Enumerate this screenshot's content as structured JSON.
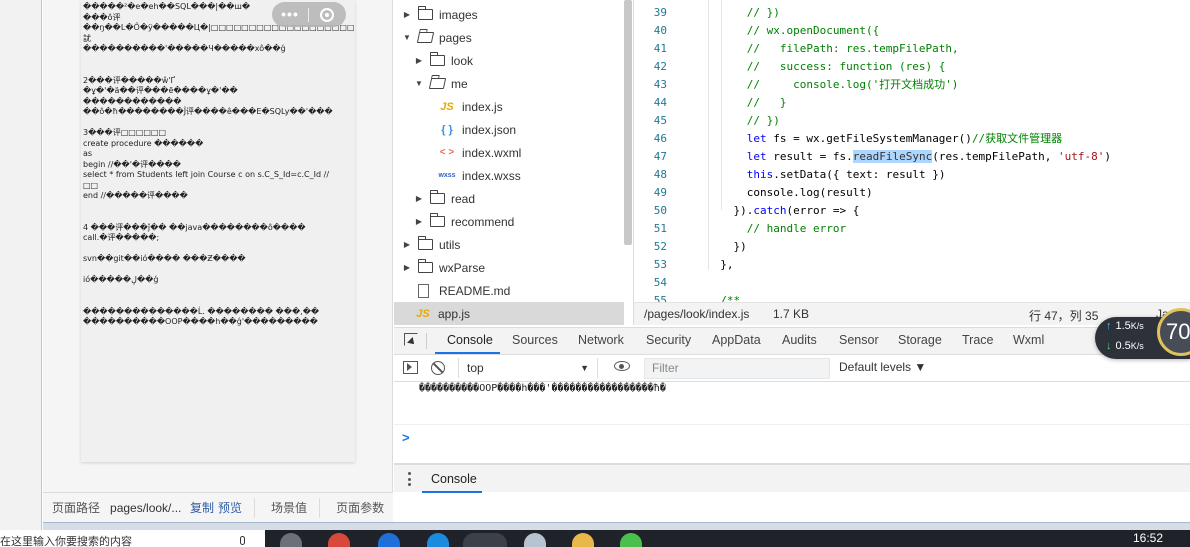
{
  "simulator": {
    "page_lines": [
      "�����²�e�eh��SQL���|��ш�",
      "���ô评",
      "��ŋ��L�Ő�ÿ�����Ц�|□□□□□□□□□□□□□□□□□□□□□â",
      "訧",
      "����������'�����Ч�����xô��ǵ",
      "",
      "",
      "2���评�����ŵ'Ґ",
      "�ұ�'�ä��评���ē����ұ�'��",
      "������������",
      "��ô�ħ��������Ĵ评����ê���E�SQLy��'���",
      "",
      "3���评□□□□□□",
      "create procedure ������",
      "as",
      "begin //��'�评����",
      "select * from Students left join Course c on s.C_S_Id=c.C_Id //",
      "□□",
      "end //�����评����",
      "",
      "",
      "4 ���评���ǰ�� ��java��������ô����",
      "call.�评�����;",
      "",
      "svn��git��ió���� ���Ƶ����",
      "",
      "ió�����ڸ��ǵ",
      "",
      "",
      "��������������Ĺ. �������� ���,��",
      "����������OOP����h��ǵ'���������"
    ],
    "capsule_more": "•••",
    "footer": {
      "path_label": "页面路径",
      "path_value": "pages/look/...",
      "copy": "复制",
      "preview": "预览",
      "scene": "场景值",
      "params": "页面参数"
    }
  },
  "file_tree": [
    {
      "name": "images",
      "type": "folder",
      "expanded": false,
      "depth": 0
    },
    {
      "name": "pages",
      "type": "folder",
      "expanded": true,
      "depth": 0
    },
    {
      "name": "look",
      "type": "folder",
      "expanded": false,
      "depth": 1
    },
    {
      "name": "me",
      "type": "folder",
      "expanded": true,
      "depth": 1
    },
    {
      "name": "index.js",
      "type": "js",
      "depth": 2,
      "icon": "JS"
    },
    {
      "name": "index.json",
      "type": "json",
      "depth": 2,
      "icon": "{ }"
    },
    {
      "name": "index.wxml",
      "type": "wxml",
      "depth": 2,
      "icon": "< >"
    },
    {
      "name": "index.wxss",
      "type": "wxss",
      "depth": 2,
      "icon": "wxss"
    },
    {
      "name": "read",
      "type": "folder",
      "expanded": false,
      "depth": 1
    },
    {
      "name": "recommend",
      "type": "folder",
      "expanded": false,
      "depth": 1
    },
    {
      "name": "utils",
      "type": "folder",
      "expanded": false,
      "depth": 0
    },
    {
      "name": "wxParse",
      "type": "folder",
      "expanded": false,
      "depth": 0
    },
    {
      "name": "README.md",
      "type": "md",
      "depth": 0
    },
    {
      "name": "app.js",
      "type": "js",
      "depth": 0,
      "icon": "JS",
      "selected": true
    }
  ],
  "editor": {
    "lines": [
      {
        "n": "39",
        "parts": [
          {
            "t": "      // })",
            "c": "com"
          }
        ]
      },
      {
        "n": "40",
        "parts": [
          {
            "t": "      // wx.openDocument({",
            "c": "com"
          }
        ]
      },
      {
        "n": "41",
        "parts": [
          {
            "t": "      //   filePath: res.tempFilePath,",
            "c": "com"
          }
        ]
      },
      {
        "n": "42",
        "parts": [
          {
            "t": "      //   success: function (res) {",
            "c": "com"
          }
        ]
      },
      {
        "n": "43",
        "parts": [
          {
            "t": "      //     console.log('打开文档成功')",
            "c": "com"
          }
        ]
      },
      {
        "n": "44",
        "parts": [
          {
            "t": "      //   }",
            "c": "com"
          }
        ]
      },
      {
        "n": "45",
        "parts": [
          {
            "t": "      // })",
            "c": "com"
          }
        ]
      },
      {
        "n": "46",
        "parts": [
          {
            "t": "      ",
            "c": "plain"
          },
          {
            "t": "let",
            "c": "kw"
          },
          {
            "t": " fs = wx.getFileSystemManager()",
            "c": "plain"
          },
          {
            "t": "//获取文件管理器",
            "c": "com"
          }
        ]
      },
      {
        "n": "47",
        "parts": [
          {
            "t": "      ",
            "c": "plain"
          },
          {
            "t": "let",
            "c": "kw"
          },
          {
            "t": " result = fs.",
            "c": "plain"
          },
          {
            "t": "readFileSync",
            "c": "hl"
          },
          {
            "t": "(res.tempFilePath, ",
            "c": "plain"
          },
          {
            "t": "'utf-8'",
            "c": "str"
          },
          {
            "t": ")",
            "c": "plain"
          }
        ]
      },
      {
        "n": "48",
        "parts": [
          {
            "t": "      ",
            "c": "plain"
          },
          {
            "t": "this",
            "c": "kw"
          },
          {
            "t": ".setData({ text: result })",
            "c": "plain"
          }
        ]
      },
      {
        "n": "49",
        "parts": [
          {
            "t": "      console.log(result)",
            "c": "plain"
          }
        ]
      },
      {
        "n": "50",
        "parts": [
          {
            "t": "    }).",
            "c": "plain"
          },
          {
            "t": "catch",
            "c": "kw"
          },
          {
            "t": "(error => {",
            "c": "plain"
          }
        ]
      },
      {
        "n": "51",
        "parts": [
          {
            "t": "      // handle error",
            "c": "com"
          }
        ]
      },
      {
        "n": "52",
        "parts": [
          {
            "t": "    })",
            "c": "plain"
          }
        ]
      },
      {
        "n": "53",
        "parts": [
          {
            "t": "  },",
            "c": "plain"
          }
        ]
      },
      {
        "n": "54",
        "parts": [
          {
            "t": "",
            "c": "plain"
          }
        ]
      },
      {
        "n": "55",
        "parts": [
          {
            "t": "  /**",
            "c": "com"
          }
        ]
      }
    ]
  },
  "status_bar": {
    "path": "/pages/look/index.js",
    "size": "1.7 KB",
    "position": "行 47，列 35",
    "language": "JavaScript"
  },
  "devtools": {
    "tabs": [
      "Console",
      "Sources",
      "Network",
      "Security",
      "AppData",
      "Audits",
      "Sensor",
      "Storage",
      "Trace",
      "Wxml"
    ],
    "active_tab": "Console",
    "context": "top",
    "filter_placeholder": "Filter",
    "levels": "Default levels ▼",
    "log_output": "����������OOP����h���'�����������������ħ�",
    "prompt": ">",
    "drawer_tab": "Console"
  },
  "net_widget": {
    "up_speed": "1.5",
    "down_speed": "0.5",
    "unit": "K/s",
    "percent": "70"
  },
  "taskbar": {
    "left_text": "在这里输入你要搜索的内容",
    "time": "16:52"
  },
  "colors": {
    "accent": "#1a73e8",
    "comment": "#008000",
    "keyword": "#0000ff",
    "string": "#a31515",
    "line_number": "#237893",
    "selection": "#add6ff"
  }
}
